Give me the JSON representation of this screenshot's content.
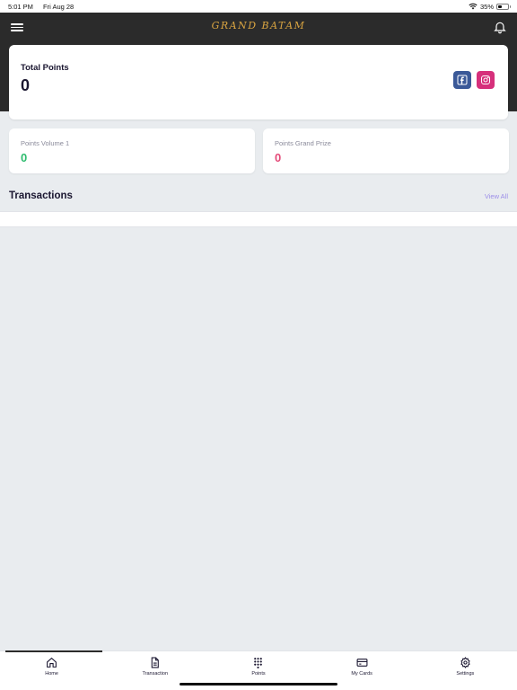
{
  "status_bar": {
    "time": "5:01 PM",
    "date": "Fri Aug 28",
    "battery": "35%",
    "battery_level": 0.35,
    "icons": [
      "wifi-icon",
      "battery-icon"
    ]
  },
  "header": {
    "brand": "GRAND BATAM",
    "icons": [
      "menu-icon",
      "bell-icon"
    ],
    "colors": {
      "background": "#2b2b2b",
      "brand": "#d9a441"
    }
  },
  "total_points": {
    "label": "Total Points",
    "value": "0",
    "social_icons": [
      "facebook-icon",
      "instagram-icon"
    ]
  },
  "points_volume": {
    "label": "Points Volume 1",
    "value": "0",
    "color": "#2ebc6e"
  },
  "points_grand_prize": {
    "label": "Points Grand Prize",
    "value": "0",
    "color": "#e44a78"
  },
  "transactions": {
    "title": "Transactions",
    "view_all": "View All",
    "items": []
  },
  "bottom_nav": {
    "active": "Home",
    "items": [
      {
        "label": "Home",
        "icon": "home-icon"
      },
      {
        "label": "Transaction",
        "icon": "document-icon"
      },
      {
        "label": "Points",
        "icon": "grid-dots-icon"
      },
      {
        "label": "My Cards",
        "icon": "card-icon"
      },
      {
        "label": "Settings",
        "icon": "gear-icon"
      }
    ]
  }
}
